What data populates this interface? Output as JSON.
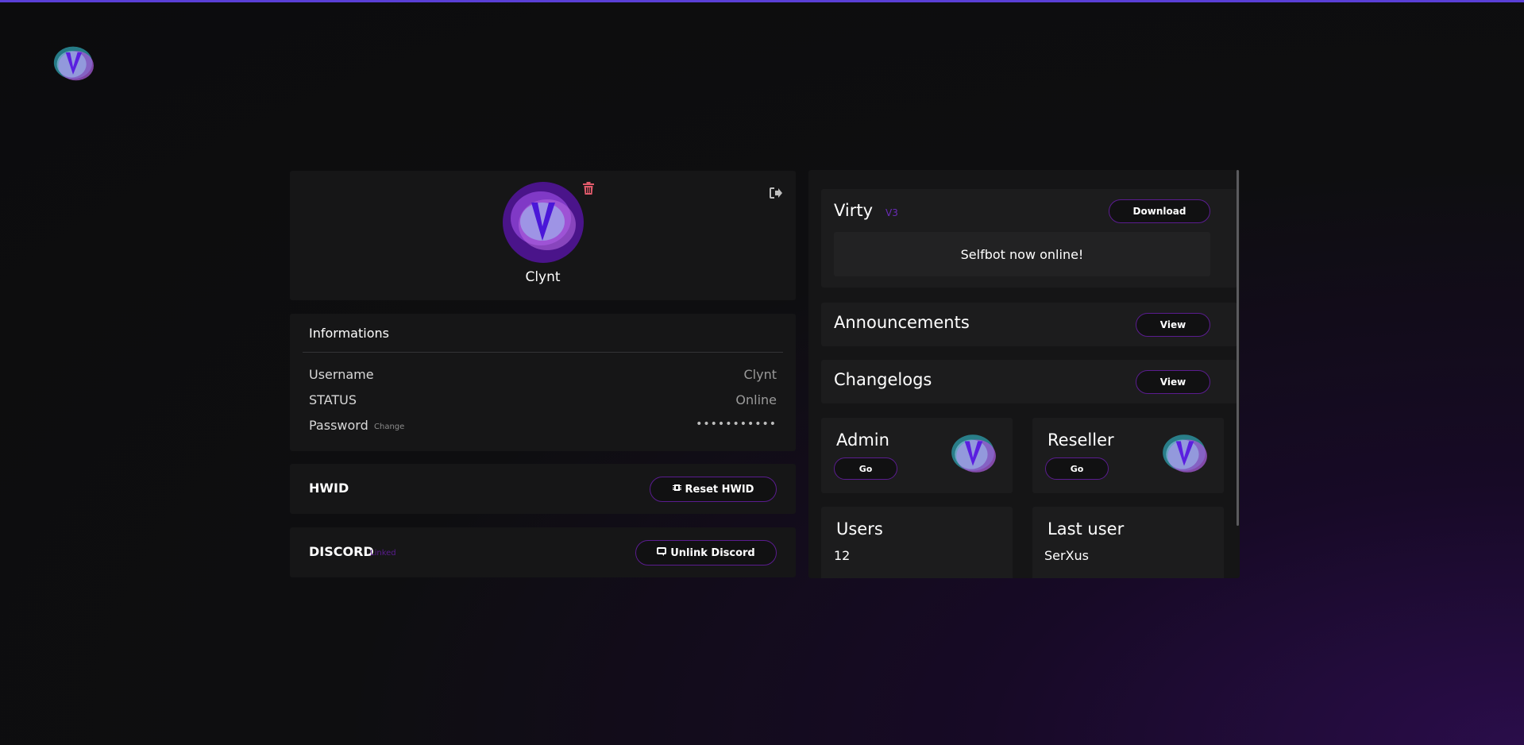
{
  "profile": {
    "username": "Clynt",
    "delete_icon": "trash-icon",
    "logout_icon": "sign-out-icon"
  },
  "informations": {
    "title": "Informations",
    "rows": [
      {
        "label": "Username",
        "value": "Clynt"
      },
      {
        "label": "STATUS",
        "value": "Online"
      },
      {
        "label": "Password",
        "extra": "Change",
        "value": "•••••••••••"
      }
    ]
  },
  "hwid": {
    "title": "HWID",
    "button": "Reset HWID",
    "icon": "chip-icon"
  },
  "discord": {
    "title": "DISCORD",
    "status": "Linked",
    "button": "Unlink Discord",
    "icon": "discord-icon"
  },
  "product": {
    "name": "Virty",
    "version": "V3",
    "download": "Download",
    "status_message": "Selfbot now online!"
  },
  "announcements": {
    "title": "Announcements",
    "button": "View"
  },
  "changelogs": {
    "title": "Changelogs",
    "button": "View"
  },
  "admin": {
    "title": "Admin",
    "button": "Go"
  },
  "reseller": {
    "title": "Reseller",
    "button": "Go"
  },
  "users": {
    "title": "Users",
    "count": "12"
  },
  "last_user": {
    "title": "Last user",
    "name": "SerXus"
  },
  "colors": {
    "accent": "#5a1c8f",
    "version": "#6a2bb8",
    "danger": "#e05a6a"
  }
}
